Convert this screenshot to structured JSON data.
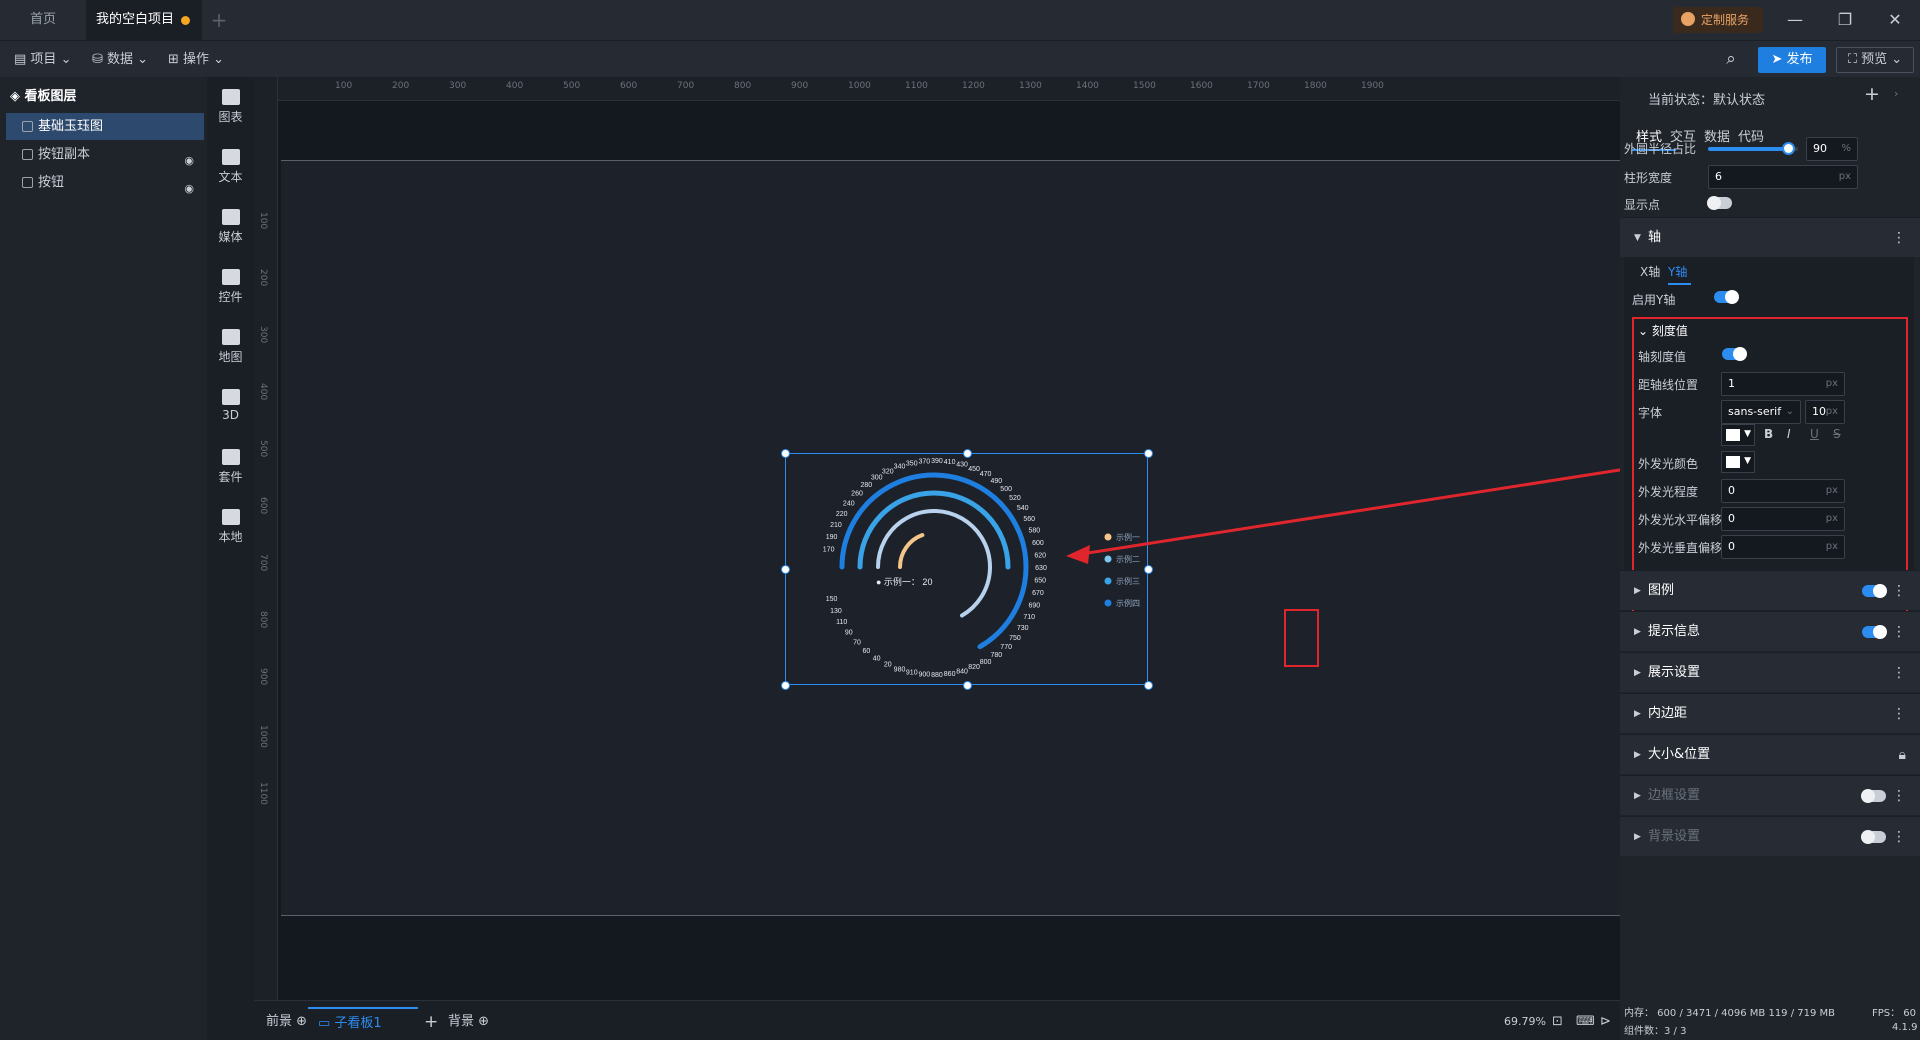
{
  "tabs": {
    "home": "首页",
    "project": "我的空白项目",
    "add": "+"
  },
  "custom_service": "定制服务",
  "toolbar": {
    "project": "项目",
    "data": "数据",
    "ops": "操作",
    "publish": "发布",
    "preview": "预览"
  },
  "layers": {
    "title": "看板图层",
    "items": [
      {
        "label": "基础玉珏图",
        "selected": true
      },
      {
        "label": "按钮副本",
        "hidden": true
      },
      {
        "label": "按钮",
        "hidden": true
      }
    ]
  },
  "components": [
    "图表",
    "文本",
    "媒体",
    "控件",
    "地图",
    "3D",
    "套件",
    "本地"
  ],
  "ruler": {
    "h": [
      "100",
      "200",
      "300",
      "400",
      "500",
      "600",
      "700",
      "800",
      "900",
      "1000",
      "1100",
      "1200",
      "1300",
      "1400",
      "1500",
      "1600",
      "1700",
      "1800",
      "1900"
    ],
    "v": [
      "100",
      "200",
      "300",
      "400",
      "500",
      "600",
      "700",
      "800",
      "900",
      "1000",
      "1100"
    ]
  },
  "chart_data": {
    "type": "radial-bar",
    "legend": [
      "示例一",
      "示例二",
      "示例三",
      "示例四"
    ],
    "legend_colors": [
      "#f5c68a",
      "#7ec7f0",
      "#3aa3e8",
      "#1e7fe0"
    ],
    "tooltip": {
      "label": "示例一：",
      "value": "20"
    },
    "axis_labels": [
      "170",
      "190",
      "210",
      "220",
      "240",
      "260",
      "280",
      "300",
      "320",
      "340",
      "350",
      "370",
      "390",
      "410",
      "430",
      "450",
      "470",
      "490",
      "500",
      "520",
      "540",
      "560",
      "580",
      "600",
      "620",
      "630",
      "650",
      "670",
      "690",
      "710",
      "730",
      "750",
      "770",
      "780",
      "800",
      "820",
      "840",
      "860",
      "880",
      "900",
      "910",
      "980",
      "20",
      "40",
      "60",
      "70",
      "90",
      "110",
      "130",
      "150"
    ],
    "series": [
      {
        "name": "示例一",
        "value": 20
      },
      {
        "name": "示例二",
        "value": null
      },
      {
        "name": "示例三",
        "value": null
      },
      {
        "name": "示例四",
        "value": null
      }
    ]
  },
  "bottom": {
    "foreground": "前景",
    "sub_board": "子看板1",
    "background": "背景",
    "zoom": "69.79%"
  },
  "panel": {
    "state_label": "当前状态：",
    "state_value": "默认状态",
    "tabs": [
      "样式",
      "交互",
      "数据",
      "代码"
    ],
    "outer_radius_label": "外圆半径占比",
    "outer_radius_value": "90",
    "outer_radius_unit": "%",
    "outer_radius_fraction": 0.9,
    "bar_width_label": "柱形宽度",
    "bar_width_value": "6",
    "bar_width_unit": "px",
    "show_points_label": "显示点",
    "axis_section": "轴",
    "axis_tabs": [
      "X轴",
      "Y轴"
    ],
    "enable_y_label": "启用Y轴",
    "ticks_section": "刻度值",
    "tick_value_label": "轴刻度值",
    "tick_distance_label": "距轴线位置",
    "tick_distance_value": "1",
    "tick_distance_unit": "px",
    "font_label": "字体",
    "font_value": "sans-serif",
    "font_size_value": "10",
    "font_size_unit": "px",
    "font_style": [
      "B",
      "I",
      "U",
      "S"
    ],
    "glow_color_label": "外发光颜色",
    "glow_level_label": "外发光程度",
    "glow_level_value": "0",
    "glow_h_label": "外发光水平偏移",
    "glow_h_value": "0",
    "glow_v_label": "外发光垂直偏移",
    "glow_v_value": "0",
    "px": "px",
    "sections": [
      "图例",
      "提示信息",
      "展示设置",
      "内边距",
      "大小&位置",
      "边框设置",
      "背景设置"
    ]
  },
  "status": {
    "memory": "内存： 600 / 3471 / 4096 MB  119 / 719 MB",
    "fps": "FPS： 60",
    "components": "组件数：3 / 3",
    "version": "4.1.9"
  }
}
